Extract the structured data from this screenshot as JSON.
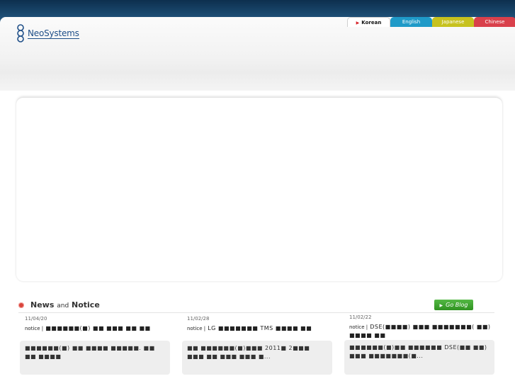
{
  "brand": {
    "name": "NeoSystems"
  },
  "languages": [
    {
      "label": "Korean",
      "selected": true
    },
    {
      "label": "English"
    },
    {
      "label": "Japanese"
    },
    {
      "label": "Chinese"
    }
  ],
  "news": {
    "title_news": "News",
    "title_and": "and",
    "title_notice": "Notice",
    "go_blog": "Go Blog",
    "items": [
      {
        "date": "11/04/20",
        "tag": "notice |",
        "headline": "■■■■■■(■) ■■ ■■■ ■■ ■■",
        "summary": "■■■■■■(■) ■■ ■■■■ ■■■■■. ■■ ■■ ■■■■"
      },
      {
        "date": "11/02/28",
        "tag": "notice |",
        "headline": "LG ■■■■■■■ TMS ■■■■ ■■",
        "summary": "■■ ■■■■■■(■)■■■ 2011■ 2■■■ ■■■ ■■ ■■■ ■■■ ■..."
      },
      {
        "date": "11/02/22",
        "tag": "notice |",
        "headline": "DSE(■■■■) ■■■ ■■■■■■■( ■■) ■■■■ ■■",
        "summary": "■■■■■■(■)■■ ■■■■■■ DSE(■■ ■■) ■■■ ■■■■■■■(■..."
      }
    ]
  },
  "colors": {
    "korean_tab": "#ffffff",
    "english_tab": "#1f9ac8",
    "japanese_tab": "#c7c21e",
    "chinese_tab": "#d9404b",
    "go_blog": "#3ea52f",
    "top_band": "#1b4a70"
  }
}
